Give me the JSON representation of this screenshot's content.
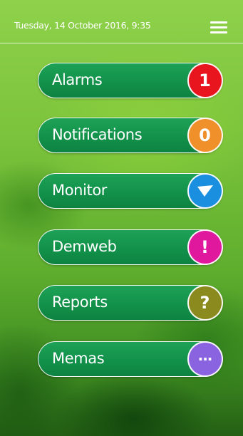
{
  "header": {
    "datetime": "Tuesday, 14 October 2016, 9:35",
    "menu_icon": "hamburger-menu-icon"
  },
  "colors": {
    "item_fill": "#129149",
    "item_border": "#ffffff",
    "background": "#6dbd36"
  },
  "menu": {
    "items": [
      {
        "label": "Alarms",
        "badge_text": "1",
        "badge_color": "#e8141e",
        "icon": "count-badge"
      },
      {
        "label": "Notifications",
        "badge_text": "0",
        "badge_color": "#f0902a",
        "icon": "count-badge"
      },
      {
        "label": "Monitor",
        "badge_text": "",
        "badge_color": "#1a8fe0",
        "icon": "checkmark-icon"
      },
      {
        "label": "Demweb",
        "badge_text": "!",
        "badge_color": "#e0189e",
        "icon": "exclamation-icon"
      },
      {
        "label": "Reports",
        "badge_text": "?",
        "badge_color": "#8b8a1e",
        "icon": "question-icon"
      },
      {
        "label": "Memas",
        "badge_text": "···",
        "badge_color": "#8a63e0",
        "icon": "ellipsis-icon"
      }
    ]
  }
}
